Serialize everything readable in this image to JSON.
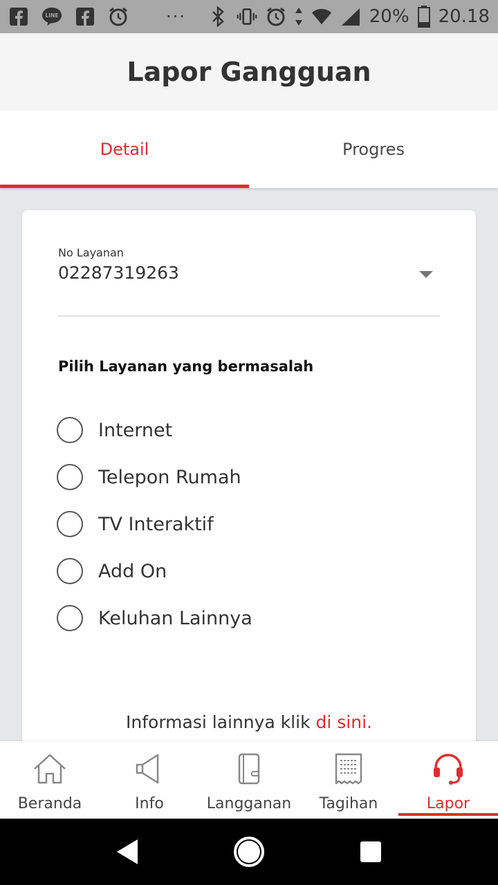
{
  "status_bar": {
    "battery_text": "20%",
    "time": "20.18",
    "overflow": "···",
    "left_icons": [
      "facebook-icon",
      "line-icon",
      "facebook-icon",
      "alarm-icon"
    ],
    "right_icons": [
      "bluetooth-icon",
      "vibrate-icon",
      "alarm-icon",
      "data-arrows-icon",
      "wifi-icon",
      "signal-icon",
      "battery-icon"
    ]
  },
  "app_bar": {
    "title": "Lapor Gangguan"
  },
  "tabs": [
    {
      "label": "Detail",
      "active": true
    },
    {
      "label": "Progres",
      "active": false
    }
  ],
  "form": {
    "no_layanan_label": "No Layanan",
    "no_layanan_value": "02287319263",
    "section_title": "Pilih Layanan yang bermasalah",
    "options": [
      {
        "label": "Internet",
        "checked": false
      },
      {
        "label": "Telepon Rumah",
        "checked": false
      },
      {
        "label": "TV Interaktif",
        "checked": false
      },
      {
        "label": "Add On",
        "checked": false
      },
      {
        "label": "Keluhan Lainnya",
        "checked": false
      }
    ],
    "info_text": "Informasi lainnya klik ",
    "info_link": "di sini."
  },
  "bottom_nav": [
    {
      "label": "Beranda",
      "icon": "home-icon",
      "active": false
    },
    {
      "label": "Info",
      "icon": "megaphone-icon",
      "active": false
    },
    {
      "label": "Langganan",
      "icon": "wallet-icon",
      "active": false
    },
    {
      "label": "Tagihan",
      "icon": "receipt-icon",
      "active": false
    },
    {
      "label": "Lapor",
      "icon": "headset-icon",
      "active": true
    }
  ],
  "colors": {
    "accent": "#e02d2d",
    "status_bar_bg": "#a8a8a8",
    "app_bar_bg": "#f5f5f5",
    "page_bg": "#e6e7e9"
  }
}
